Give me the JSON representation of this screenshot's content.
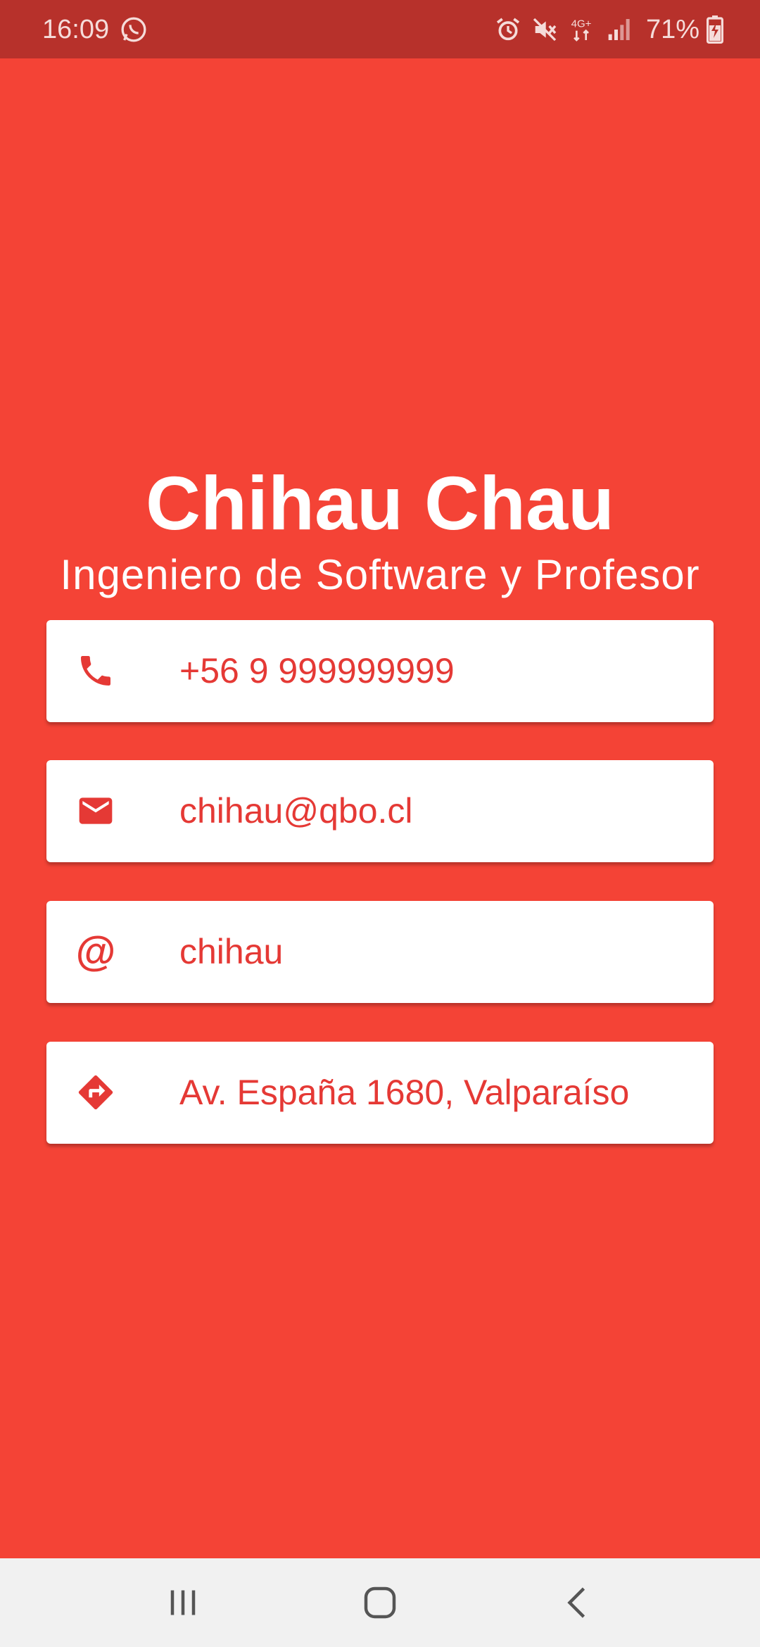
{
  "status_bar": {
    "time": "16:09",
    "network": "4G+",
    "battery": "71%"
  },
  "profile": {
    "name": "Chihau Chau",
    "title": "Ingeniero de Software y Profesor"
  },
  "contacts": [
    {
      "icon": "phone-icon",
      "value": "+56 9 999999999"
    },
    {
      "icon": "email-icon",
      "value": "chihau@qbo.cl"
    },
    {
      "icon": "at-icon",
      "value": "chihau"
    },
    {
      "icon": "directions-icon",
      "value": "Av. España 1680, Valparaíso"
    }
  ],
  "colors": {
    "background": "#f44336",
    "status_bar": "#b7312b",
    "accent_text": "#e53935",
    "card": "#ffffff",
    "nav_bar": "#f1f1f1"
  }
}
